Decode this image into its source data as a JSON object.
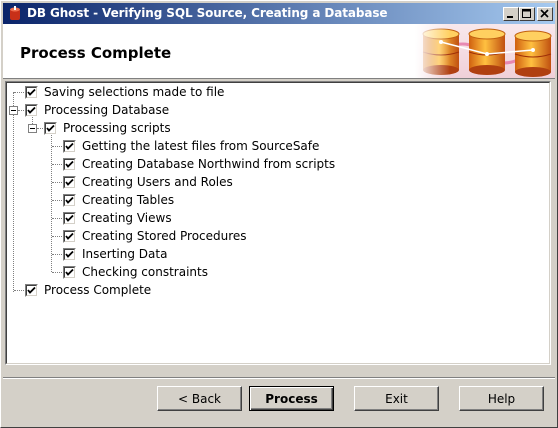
{
  "window": {
    "title": "DB Ghost - Verifying SQL Source, Creating a Database"
  },
  "header": {
    "title": "Process Complete"
  },
  "tree": {
    "items": [
      {
        "label": "Saving selections made to file",
        "checked": true
      },
      {
        "label": "Processing Database",
        "checked": true,
        "expanded": true
      },
      {
        "label": "Processing scripts",
        "checked": true,
        "expanded": true
      },
      {
        "label": "Getting the latest files from SourceSafe",
        "checked": true
      },
      {
        "label": "Creating Database Northwind from scripts",
        "checked": true
      },
      {
        "label": "Creating Users and Roles",
        "checked": true
      },
      {
        "label": "Creating Tables",
        "checked": true
      },
      {
        "label": "Creating Views",
        "checked": true
      },
      {
        "label": "Creating Stored Procedures",
        "checked": true
      },
      {
        "label": "Inserting Data",
        "checked": true
      },
      {
        "label": "Checking constraints",
        "checked": true
      },
      {
        "label": "Process Complete",
        "checked": true
      }
    ]
  },
  "buttons": {
    "back": "< Back",
    "process": "Process",
    "exit": "Exit",
    "help": "Help"
  },
  "icons": {
    "app": "db-ghost-icon",
    "header_art": "database-cylinders-icon"
  },
  "colors": {
    "titlebar_start": "#0a246a",
    "titlebar_end": "#a6caf0",
    "cylinder": "#f0a020"
  }
}
